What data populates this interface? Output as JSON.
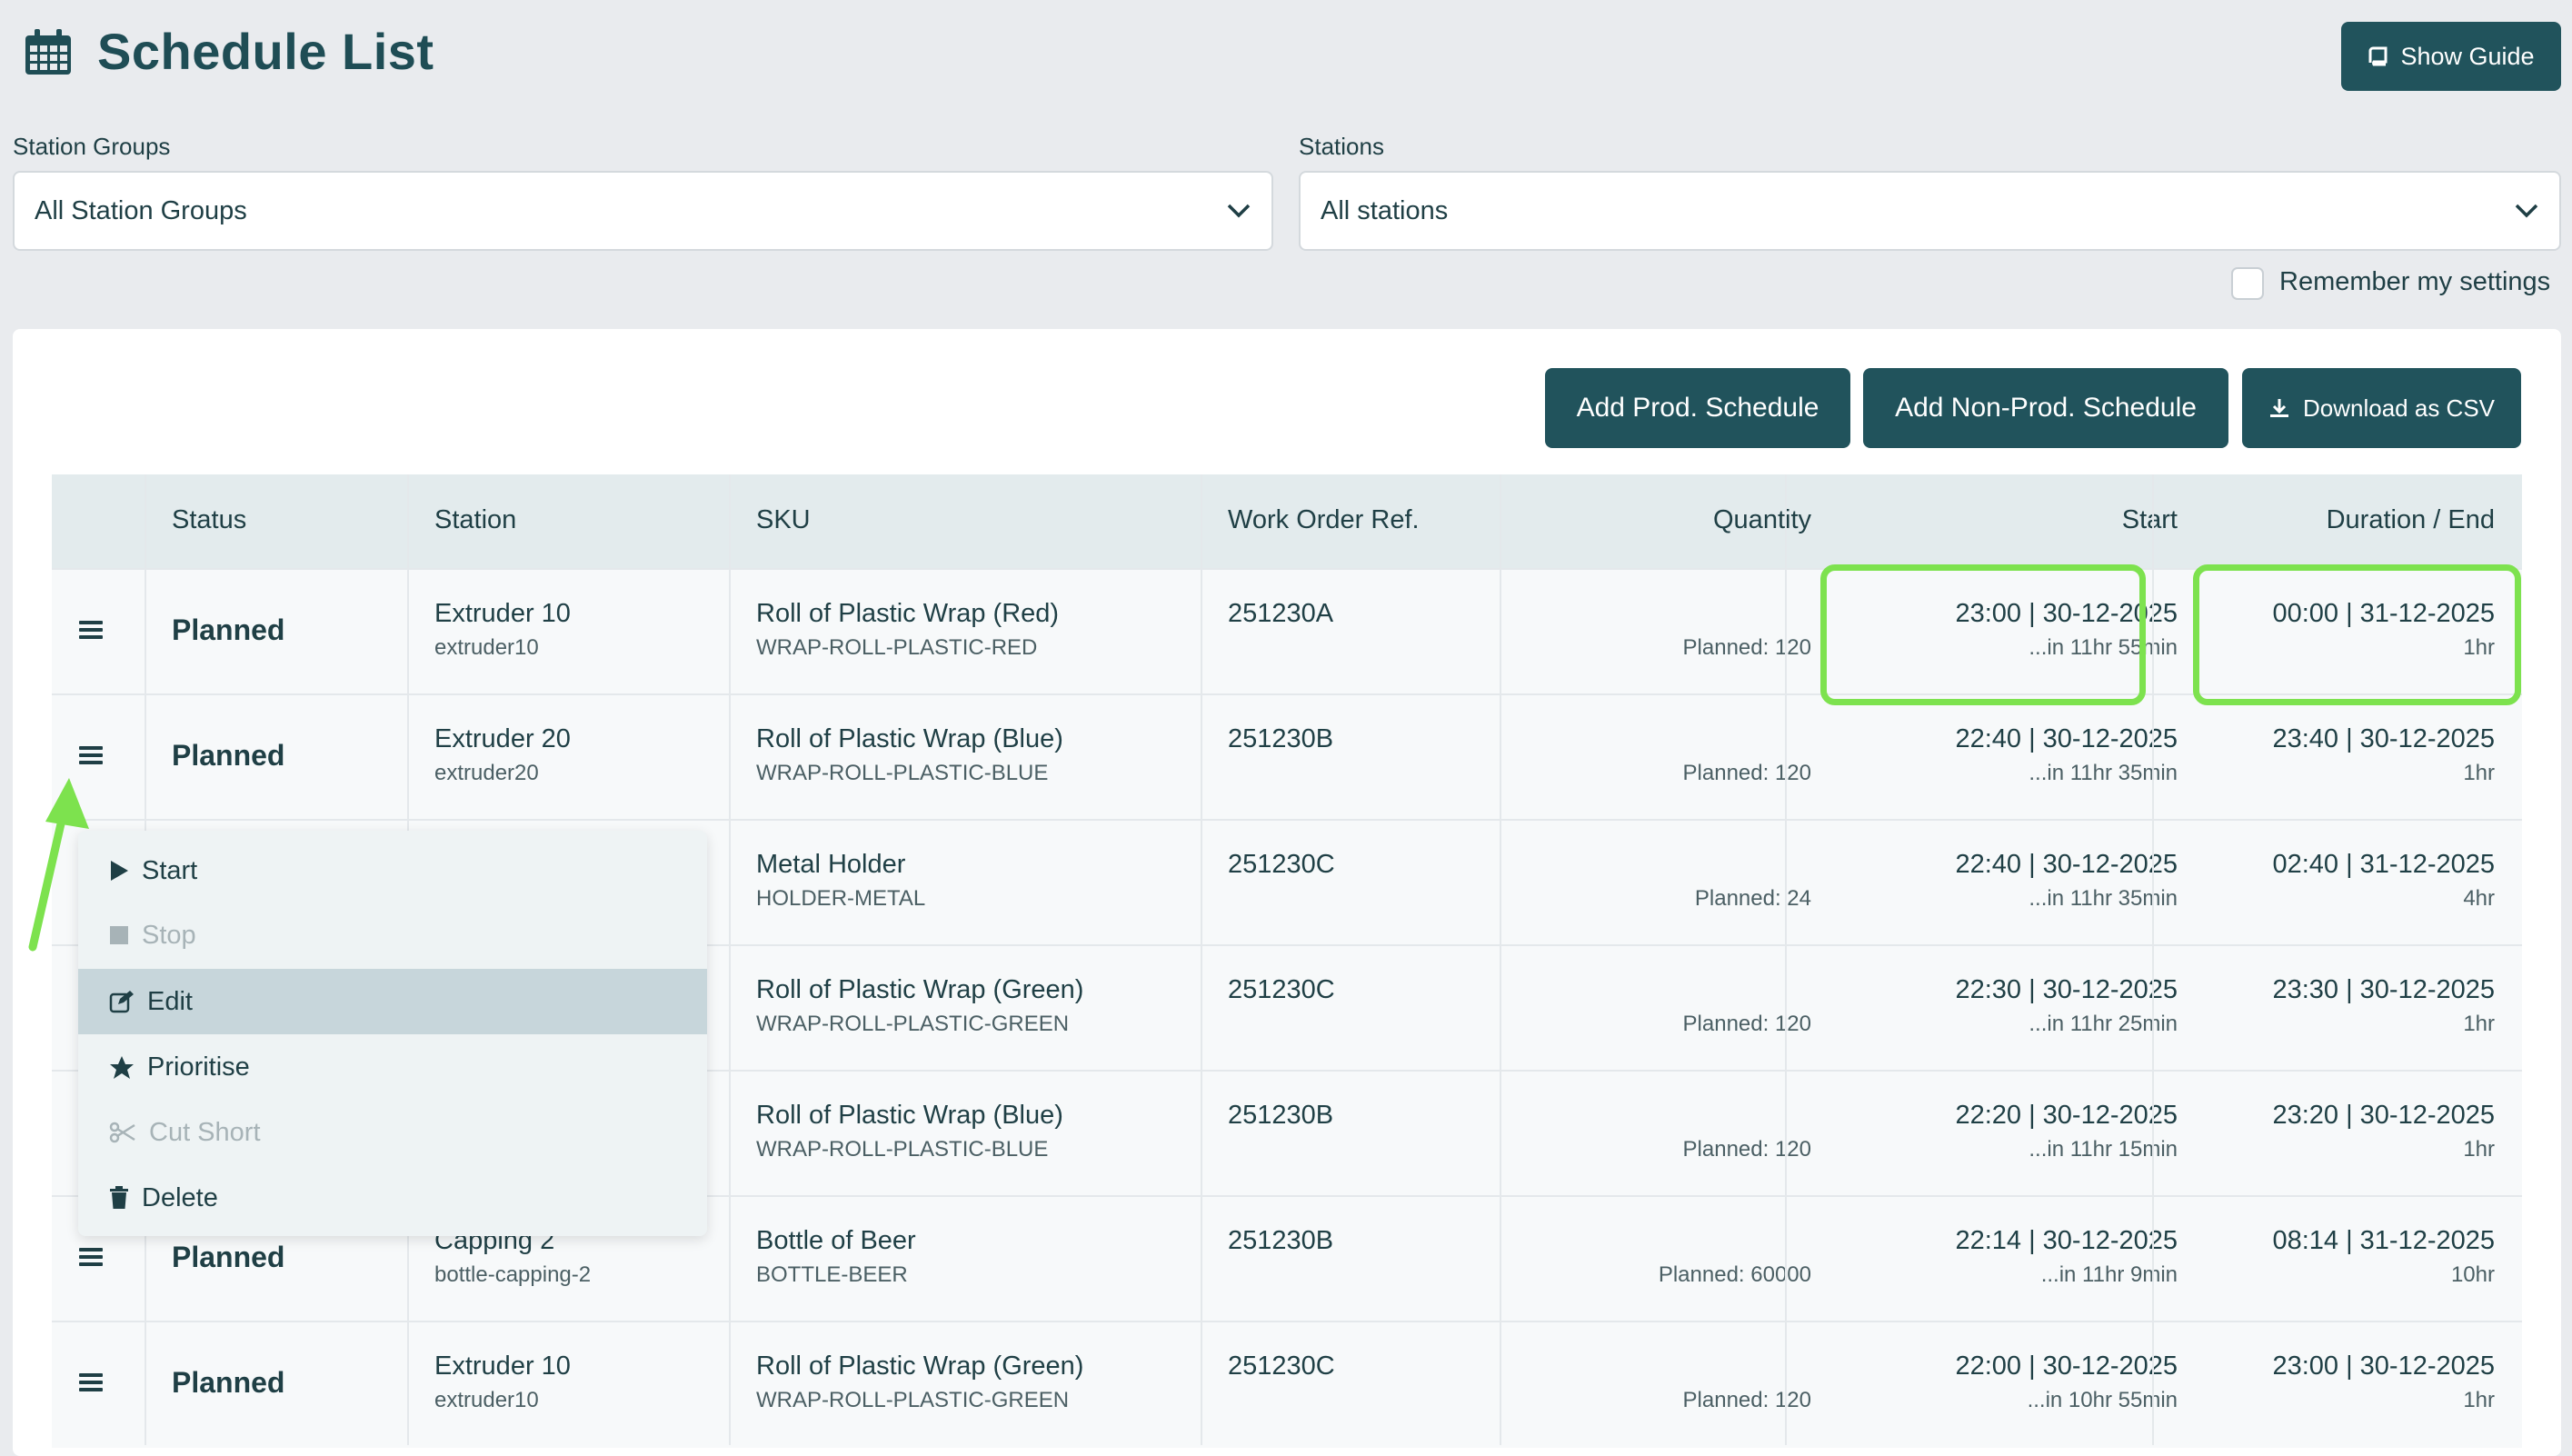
{
  "header": {
    "title": "Schedule List",
    "guide_label": "Show Guide"
  },
  "filters": {
    "station_groups_label": "Station Groups",
    "station_groups_value": "All Station Groups",
    "stations_label": "Stations",
    "stations_value": "All stations",
    "remember_label": "Remember my settings"
  },
  "actions": {
    "add_prod": "Add Prod. Schedule",
    "add_nonprod": "Add Non-Prod. Schedule",
    "download": "Download as CSV"
  },
  "table": {
    "columns": [
      "Status",
      "Station",
      "SKU",
      "Work Order Ref.",
      "Quantity",
      "Start",
      "Duration / End"
    ],
    "rows": [
      {
        "status": "Planned",
        "station": "Extruder 10",
        "station_id": "extruder10",
        "sku": "Roll of Plastic Wrap (Red)",
        "sku_code": "WRAP-ROLL-PLASTIC-RED",
        "wo": "251230A",
        "qty": "Planned: 120",
        "start": "23:00 | 30-12-2025",
        "start_rel": "...in 11hr 55min",
        "end": "00:00 | 31-12-2025",
        "duration": "1hr"
      },
      {
        "status": "Planned",
        "station": "Extruder 20",
        "station_id": "extruder20",
        "sku": "Roll of Plastic Wrap (Blue)",
        "sku_code": "WRAP-ROLL-PLASTIC-BLUE",
        "wo": "251230B",
        "qty": "Planned: 120",
        "start": "22:40 | 30-12-2025",
        "start_rel": "...in 11hr 35min",
        "end": "23:40 | 30-12-2025",
        "duration": "1hr"
      },
      {
        "status": "",
        "station": "",
        "station_id": "",
        "sku": "Metal Holder",
        "sku_code": "HOLDER-METAL",
        "wo": "251230C",
        "qty": "Planned: 24",
        "start": "22:40 | 30-12-2025",
        "start_rel": "...in 11hr 35min",
        "end": "02:40 | 31-12-2025",
        "duration": "4hr"
      },
      {
        "status": "",
        "station": "",
        "station_id": "",
        "sku": "Roll of Plastic Wrap (Green)",
        "sku_code": "WRAP-ROLL-PLASTIC-GREEN",
        "wo": "251230C",
        "qty": "Planned: 120",
        "start": "22:30 | 30-12-2025",
        "start_rel": "...in 11hr 25min",
        "end": "23:30 | 30-12-2025",
        "duration": "1hr"
      },
      {
        "status": "",
        "station": "",
        "station_id": "",
        "sku": "Roll of Plastic Wrap (Blue)",
        "sku_code": "WRAP-ROLL-PLASTIC-BLUE",
        "wo": "251230B",
        "qty": "Planned: 120",
        "start": "22:20 | 30-12-2025",
        "start_rel": "...in 11hr 15min",
        "end": "23:20 | 30-12-2025",
        "duration": "1hr"
      },
      {
        "status": "Planned",
        "station": "Capping 2",
        "station_id": "bottle-capping-2",
        "sku": "Bottle of Beer",
        "sku_code": "BOTTLE-BEER",
        "wo": "251230B",
        "qty": "Planned: 60000",
        "start": "22:14 | 30-12-2025",
        "start_rel": "...in 11hr 9min",
        "end": "08:14 | 31-12-2025",
        "duration": "10hr"
      },
      {
        "status": "Planned",
        "station": "Extruder 10",
        "station_id": "extruder10",
        "sku": "Roll of Plastic Wrap (Green)",
        "sku_code": "WRAP-ROLL-PLASTIC-GREEN",
        "wo": "251230C",
        "qty": "Planned: 120",
        "start": "22:00 | 30-12-2025",
        "start_rel": "...in 10hr 55min",
        "end": "23:00 | 30-12-2025",
        "duration": "1hr"
      }
    ]
  },
  "menu": {
    "start": "Start",
    "stop": "Stop",
    "edit": "Edit",
    "prioritise": "Prioritise",
    "cut_short": "Cut Short",
    "delete": "Delete"
  },
  "colors": {
    "primary": "#21535c",
    "highlight": "#7de24e",
    "background": "#e9ebee"
  }
}
